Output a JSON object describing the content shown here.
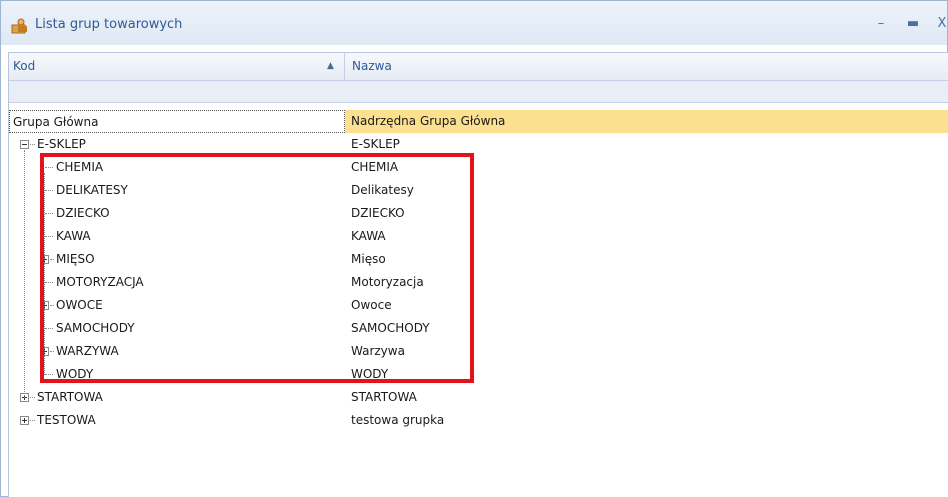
{
  "window": {
    "title": "Lista grup towarowych",
    "icon": "folder-person-icon"
  },
  "window_controls": {
    "minimize": "–",
    "maximize": "▬",
    "close": "X"
  },
  "columns": {
    "kod": "Kod",
    "nazwa": "Nazwa",
    "sort_indicator": "▲"
  },
  "rows": [
    {
      "kod": "Grupa Główna",
      "nazwa": "Nadrzędna Grupa Główna"
    },
    {
      "kod": "E-SKLEP",
      "nazwa": "E-SKLEP"
    },
    {
      "kod": "CHEMIA",
      "nazwa": "CHEMIA"
    },
    {
      "kod": "DELIKATESY",
      "nazwa": "Delikatesy"
    },
    {
      "kod": "DZIECKO",
      "nazwa": "DZIECKO"
    },
    {
      "kod": "KAWA",
      "nazwa": "KAWA"
    },
    {
      "kod": "MIĘSO",
      "nazwa": "Mięso"
    },
    {
      "kod": "MOTORYZACJA",
      "nazwa": "Motoryzacja"
    },
    {
      "kod": "OWOCE",
      "nazwa": "Owoce"
    },
    {
      "kod": "SAMOCHODY",
      "nazwa": "SAMOCHODY"
    },
    {
      "kod": "WARZYWA",
      "nazwa": "Warzywa"
    },
    {
      "kod": "WODY",
      "nazwa": "WODY"
    },
    {
      "kod": "STARTOWA",
      "nazwa": "STARTOWA"
    },
    {
      "kod": "TESTOWA",
      "nazwa": "testowa grupka"
    }
  ]
}
